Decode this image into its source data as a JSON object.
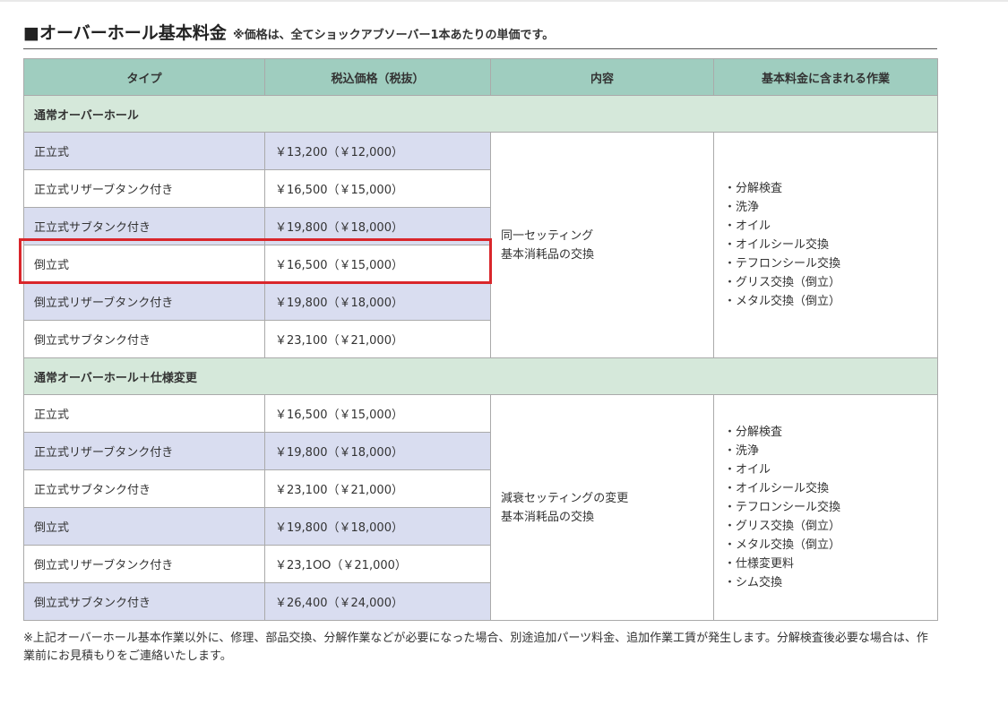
{
  "header": {
    "title": "■オーバーホール基本料金",
    "note": "※価格は、全てショックアブソーバー1本あたりの単価です。"
  },
  "table": {
    "columns": [
      "タイプ",
      "税込価格（税抜）",
      "内容",
      "基本料金に含まれる作業"
    ],
    "sections": [
      {
        "title": "通常オーバーホール",
        "rows": [
          {
            "type": "正立式",
            "price": "￥13,200（￥12,000）"
          },
          {
            "type": "正立式リザーブタンク付き",
            "price": "￥16,500（￥15,000）"
          },
          {
            "type": "正立式サブタンク付き",
            "price": "￥19,800（￥18,000）"
          },
          {
            "type": "倒立式",
            "price": "￥16,500（￥15,000）"
          },
          {
            "type": "倒立式リザーブタンク付き",
            "price": "￥19,800（￥18,000）"
          },
          {
            "type": "倒立式サブタンク付き",
            "price": "￥23,100（￥21,000）"
          }
        ],
        "content": [
          "同一セッティング",
          "基本消耗品の交換"
        ],
        "work": [
          "・分解検査",
          "・洗浄",
          "・オイル",
          "・オイルシール交換",
          "・テフロンシール交換",
          "・グリス交換（倒立）",
          "・メタル交換（倒立）"
        ]
      },
      {
        "title": "通常オーバーホール＋仕様変更",
        "rows": [
          {
            "type": "正立式",
            "price": "￥16,500（￥15,000）"
          },
          {
            "type": "正立式リザーブタンク付き",
            "price": "￥19,800（￥18,000）"
          },
          {
            "type": "正立式サブタンク付き",
            "price": "￥23,100（￥21,000）"
          },
          {
            "type": "倒立式",
            "price": "￥19,800（￥18,000）"
          },
          {
            "type": "倒立式リザーブタンク付き",
            "price": "￥23,1OO（￥21,000）"
          },
          {
            "type": "倒立式サブタンク付き",
            "price": "￥26,400（￥24,000）"
          }
        ],
        "content": [
          "減衰セッティングの変更",
          "基本消耗品の交換"
        ],
        "work": [
          "・分解検査",
          "・洗浄",
          "・オイル",
          "・オイルシール交換",
          "・テフロンシール交換",
          "・グリス交換（倒立）",
          "・メタル交換（倒立）",
          "・仕様変更料",
          "・シム交換"
        ]
      }
    ]
  },
  "footnote": "※上記オーバーホール基本作業以外に、修理、部品交換、分解作業などが必要になった場合、別途追加パーツ料金、追加作業工賃が発生します。分解検査後必要な場合は、作業前にお見積もりをご連絡いたします。",
  "colors": {
    "header_row": "#9fcdbf",
    "section_row": "#d5e8da",
    "shaded_row": "#d9ddf0",
    "highlight_border": "#d9262b"
  }
}
